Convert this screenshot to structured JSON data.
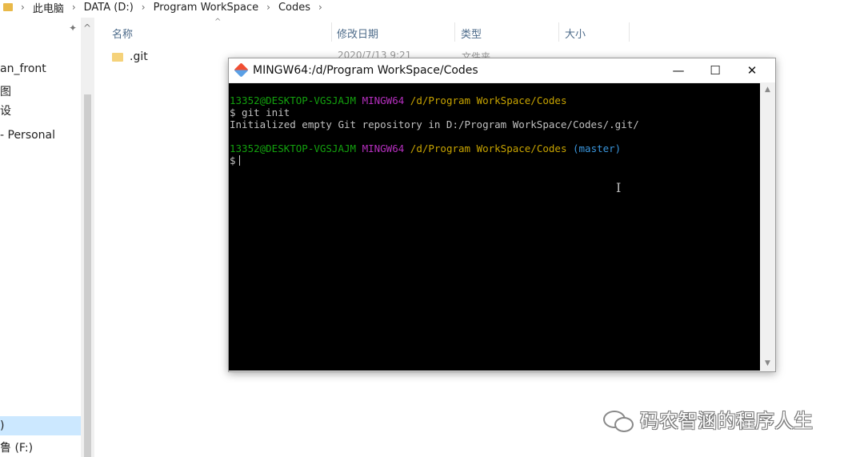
{
  "explorer": {
    "breadcrumb": [
      "此电脑",
      "DATA (D:)",
      "Program WorkSpace",
      "Codes"
    ],
    "nav_items": [
      "an_front",
      "图",
      "设",
      "- Personal",
      ")",
      "鲁 (F:)"
    ],
    "columns": {
      "name": "名称",
      "modified": "修改日期",
      "type": "类型",
      "size": "大小"
    },
    "file": {
      "name": ".git",
      "modified_peek": "2020/7/13 9:21",
      "type_peek": "文件夹"
    }
  },
  "terminal": {
    "title": "MINGW64:/d/Program WorkSpace/Codes",
    "controls": {
      "minimize": "—",
      "maximize": "☐",
      "close": "✕"
    },
    "prompt1": {
      "user": "13352@DESKTOP-VGSJAJM",
      "shell": "MINGW64",
      "path": "/d/Program WorkSpace/Codes"
    },
    "command": "$ git init",
    "output": "Initialized empty Git repository in D:/Program WorkSpace/Codes/.git/",
    "prompt2": {
      "user": "13352@DESKTOP-VGSJAJM",
      "shell": "MINGW64",
      "path": "/d/Program WorkSpace/Codes",
      "branch": "(master)"
    },
    "input_prompt": "$"
  },
  "watermark": "码农智涵的程序人生",
  "colors": {
    "user": "#13a10e",
    "shell": "#b62fbf",
    "path": "#c8a400",
    "branch": "#3a96dd"
  }
}
